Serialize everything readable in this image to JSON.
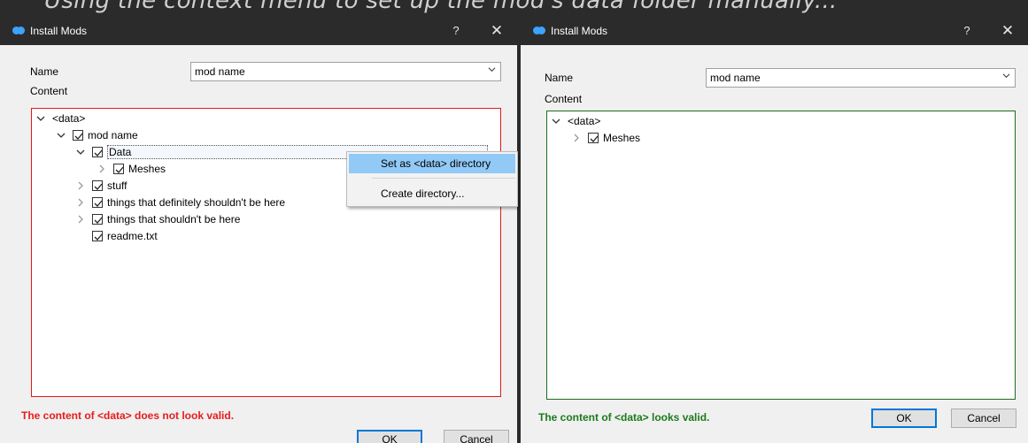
{
  "caption": "Using the context menu to set up the mod's data folder manually...",
  "colors": {
    "invalid": "#e61c1c",
    "valid": "#1c7a1c",
    "accent": "#0078d7",
    "titlebar": "#2b2b2b",
    "menu_highlight": "#91c9f7"
  },
  "left_window": {
    "title": "Install Mods",
    "help_label": "?",
    "close_label": "✕",
    "name_label": "Name",
    "name_value": "mod name",
    "content_label": "Content",
    "tree": [
      {
        "label": "<data>",
        "checked": false,
        "has_checkbox": false,
        "expander": "expanded",
        "level": 0
      },
      {
        "label": "mod name",
        "checked": true,
        "has_checkbox": true,
        "expander": "expanded",
        "level": 1
      },
      {
        "label": "Data",
        "checked": true,
        "has_checkbox": true,
        "expander": "expanded",
        "level": 2,
        "selected": true
      },
      {
        "label": "Meshes",
        "checked": true,
        "has_checkbox": true,
        "expander": "collapsed",
        "level": 3
      },
      {
        "label": "stuff",
        "checked": true,
        "has_checkbox": true,
        "expander": "collapsed",
        "level": 2
      },
      {
        "label": "things that definitely shouldn't be here",
        "checked": true,
        "has_checkbox": true,
        "expander": "collapsed",
        "level": 2
      },
      {
        "label": "things that shouldn't be here",
        "checked": true,
        "has_checkbox": true,
        "expander": "collapsed",
        "level": 2
      },
      {
        "label": "readme.txt",
        "checked": true,
        "has_checkbox": true,
        "expander": "none",
        "level": 2
      }
    ],
    "context_menu": {
      "items": [
        "Set as <data> directory",
        "Create directory..."
      ],
      "highlighted_index": 0
    },
    "status": "The content of <data> does not look valid.",
    "ok_label": "OK",
    "cancel_label": "Cancel"
  },
  "right_window": {
    "title": "Install Mods",
    "help_label": "?",
    "close_label": "✕",
    "name_label": "Name",
    "name_value": "mod name",
    "content_label": "Content",
    "tree": [
      {
        "label": "<data>",
        "checked": false,
        "has_checkbox": false,
        "expander": "expanded",
        "level": 0
      },
      {
        "label": "Meshes",
        "checked": true,
        "has_checkbox": true,
        "expander": "collapsed",
        "level": 1
      }
    ],
    "status": "The content of <data> looks valid.",
    "ok_label": "OK",
    "cancel_label": "Cancel"
  }
}
